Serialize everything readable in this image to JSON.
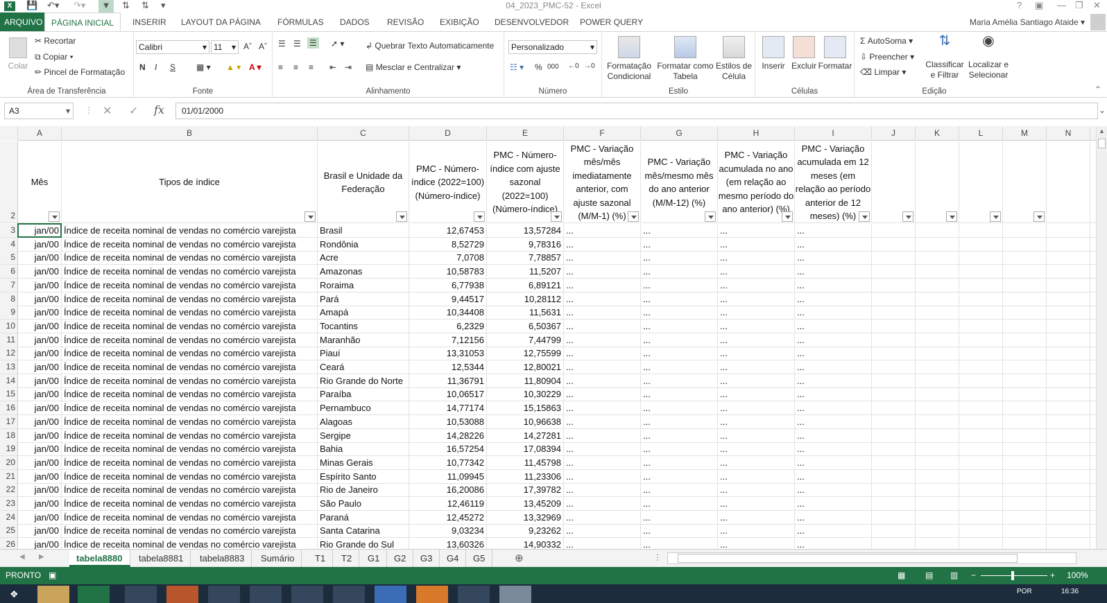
{
  "window": {
    "title": "04_2023_PMC-52 - Excel",
    "help": "?"
  },
  "tabs": [
    "ARQUIVO",
    "PÁGINA INICIAL",
    "INSERIR",
    "LAYOUT DA PÁGINA",
    "FÓRMULAS",
    "DADOS",
    "REVISÃO",
    "EXIBIÇÃO",
    "DESENVOLVEDOR",
    "POWER QUERY"
  ],
  "user": "Maria Amélia Santiago Ataide",
  "ribbon": {
    "clipboard": {
      "paste": "Colar",
      "cut": "Recortar",
      "copy": "Copiar",
      "painter": "Pincel de Formatação",
      "label": "Área de Transferência"
    },
    "font": {
      "name": "Calibri",
      "size": "11",
      "label": "Fonte",
      "bold": "N",
      "italic": "I",
      "underline": "S"
    },
    "alignment": {
      "wrap": "Quebrar Texto Automaticamente",
      "merge": "Mesclar e Centralizar",
      "label": "Alinhamento"
    },
    "number": {
      "format": "Personalizado",
      "label": "Número",
      "percent": "%",
      "thousands": "000"
    },
    "styles": {
      "cond": "Formatação Condicional",
      "table": "Formatar como Tabela",
      "cell": "Estilos de Célula",
      "label": "Estilo"
    },
    "cells": {
      "insert": "Inserir",
      "delete": "Excluir",
      "format": "Formatar",
      "label": "Células"
    },
    "editing": {
      "autosum": "AutoSoma",
      "fill": "Preencher",
      "clear": "Limpar",
      "sort": "Classificar e Filtrar",
      "find": "Localizar e Selecionar",
      "label": "Edição"
    }
  },
  "formula": {
    "namebox": "A3",
    "value": "01/01/2000",
    "fx": "fx"
  },
  "columns": [
    "A",
    "B",
    "C",
    "D",
    "E",
    "F",
    "G",
    "H",
    "I",
    "J",
    "K",
    "L",
    "M",
    "N"
  ],
  "headers": {
    "A": "Mês",
    "B": "Tipos de índice",
    "C": "Brasil e Unidade da Federação",
    "D": "PMC - Número-índice (2022=100) (Número-índice)",
    "E": "PMC - Número-índice com ajuste sazonal (2022=100) (Número-índice)",
    "F": "PMC - Variação mês/mês imediatamente anterior, com ajuste sazonal (M/M-1) (%)",
    "G": "PMC - Variação mês/mesmo mês do ano anterior (M/M-12) (%)",
    "H": "PMC - Variação acumulada no ano (em relação ao mesmo período do ano anterior) (%)",
    "I": "PMC - Variação acumulada em 12 meses (em relação ao período anterior de 12 meses) (%)"
  },
  "rows": [
    {
      "n": "3",
      "a": "jan/00",
      "b": "Índice de receita nominal de vendas no comércio varejista",
      "c": "Brasil",
      "d": "12,67453",
      "e": "13,57284",
      "f": "...",
      "g": "...",
      "h": "...",
      "i": "..."
    },
    {
      "n": "4",
      "a": "jan/00",
      "b": "Índice de receita nominal de vendas no comércio varejista",
      "c": "Rondônia",
      "d": "8,52729",
      "e": "9,78316",
      "f": "...",
      "g": "...",
      "h": "...",
      "i": "..."
    },
    {
      "n": "5",
      "a": "jan/00",
      "b": "Índice de receita nominal de vendas no comércio varejista",
      "c": "Acre",
      "d": "7,0708",
      "e": "7,78857",
      "f": "...",
      "g": "...",
      "h": "...",
      "i": "..."
    },
    {
      "n": "6",
      "a": "jan/00",
      "b": "Índice de receita nominal de vendas no comércio varejista",
      "c": "Amazonas",
      "d": "10,58783",
      "e": "11,5207",
      "f": "...",
      "g": "...",
      "h": "...",
      "i": "..."
    },
    {
      "n": "7",
      "a": "jan/00",
      "b": "Índice de receita nominal de vendas no comércio varejista",
      "c": "Roraima",
      "d": "6,77938",
      "e": "6,89121",
      "f": "...",
      "g": "...",
      "h": "...",
      "i": "..."
    },
    {
      "n": "8",
      "a": "jan/00",
      "b": "Índice de receita nominal de vendas no comércio varejista",
      "c": "Pará",
      "d": "9,44517",
      "e": "10,28112",
      "f": "...",
      "g": "...",
      "h": "...",
      "i": "..."
    },
    {
      "n": "9",
      "a": "jan/00",
      "b": "Índice de receita nominal de vendas no comércio varejista",
      "c": "Amapá",
      "d": "10,34408",
      "e": "11,5631",
      "f": "...",
      "g": "...",
      "h": "...",
      "i": "..."
    },
    {
      "n": "10",
      "a": "jan/00",
      "b": "Índice de receita nominal de vendas no comércio varejista",
      "c": "Tocantins",
      "d": "6,2329",
      "e": "6,50367",
      "f": "...",
      "g": "...",
      "h": "...",
      "i": "..."
    },
    {
      "n": "11",
      "a": "jan/00",
      "b": "Índice de receita nominal de vendas no comércio varejista",
      "c": "Maranhão",
      "d": "7,12156",
      "e": "7,44799",
      "f": "...",
      "g": "...",
      "h": "...",
      "i": "..."
    },
    {
      "n": "12",
      "a": "jan/00",
      "b": "Índice de receita nominal de vendas no comércio varejista",
      "c": "Piauí",
      "d": "13,31053",
      "e": "12,75599",
      "f": "...",
      "g": "...",
      "h": "...",
      "i": "..."
    },
    {
      "n": "13",
      "a": "jan/00",
      "b": "Índice de receita nominal de vendas no comércio varejista",
      "c": "Ceará",
      "d": "12,5344",
      "e": "12,80021",
      "f": "...",
      "g": "...",
      "h": "...",
      "i": "..."
    },
    {
      "n": "14",
      "a": "jan/00",
      "b": "Índice de receita nominal de vendas no comércio varejista",
      "c": "Rio Grande do Norte",
      "d": "11,36791",
      "e": "11,80904",
      "f": "...",
      "g": "...",
      "h": "...",
      "i": "..."
    },
    {
      "n": "15",
      "a": "jan/00",
      "b": "Índice de receita nominal de vendas no comércio varejista",
      "c": "Paraíba",
      "d": "10,06517",
      "e": "10,30229",
      "f": "...",
      "g": "...",
      "h": "...",
      "i": "..."
    },
    {
      "n": "16",
      "a": "jan/00",
      "b": "Índice de receita nominal de vendas no comércio varejista",
      "c": "Pernambuco",
      "d": "14,77174",
      "e": "15,15863",
      "f": "...",
      "g": "...",
      "h": "...",
      "i": "..."
    },
    {
      "n": "17",
      "a": "jan/00",
      "b": "Índice de receita nominal de vendas no comércio varejista",
      "c": "Alagoas",
      "d": "10,53088",
      "e": "10,96638",
      "f": "...",
      "g": "...",
      "h": "...",
      "i": "..."
    },
    {
      "n": "18",
      "a": "jan/00",
      "b": "Índice de receita nominal de vendas no comércio varejista",
      "c": "Sergipe",
      "d": "14,28226",
      "e": "14,27281",
      "f": "...",
      "g": "...",
      "h": "...",
      "i": "..."
    },
    {
      "n": "19",
      "a": "jan/00",
      "b": "Índice de receita nominal de vendas no comércio varejista",
      "c": "Bahia",
      "d": "16,57254",
      "e": "17,08394",
      "f": "...",
      "g": "...",
      "h": "...",
      "i": "..."
    },
    {
      "n": "20",
      "a": "jan/00",
      "b": "Índice de receita nominal de vendas no comércio varejista",
      "c": "Minas Gerais",
      "d": "10,77342",
      "e": "11,45798",
      "f": "...",
      "g": "...",
      "h": "...",
      "i": "..."
    },
    {
      "n": "21",
      "a": "jan/00",
      "b": "Índice de receita nominal de vendas no comércio varejista",
      "c": "Espírito Santo",
      "d": "11,09945",
      "e": "11,23306",
      "f": "...",
      "g": "...",
      "h": "...",
      "i": "..."
    },
    {
      "n": "22",
      "a": "jan/00",
      "b": "Índice de receita nominal de vendas no comércio varejista",
      "c": "Rio de Janeiro",
      "d": "16,20086",
      "e": "17,39782",
      "f": "...",
      "g": "...",
      "h": "...",
      "i": "..."
    },
    {
      "n": "23",
      "a": "jan/00",
      "b": "Índice de receita nominal de vendas no comércio varejista",
      "c": "São Paulo",
      "d": "12,46119",
      "e": "13,45209",
      "f": "...",
      "g": "...",
      "h": "...",
      "i": "..."
    },
    {
      "n": "24",
      "a": "jan/00",
      "b": "Índice de receita nominal de vendas no comércio varejista",
      "c": "Paraná",
      "d": "12,45272",
      "e": "13,32969",
      "f": "...",
      "g": "...",
      "h": "...",
      "i": "..."
    },
    {
      "n": "25",
      "a": "jan/00",
      "b": "Índice de receita nominal de vendas no comércio varejista",
      "c": "Santa Catarina",
      "d": "9,03234",
      "e": "9,23262",
      "f": "...",
      "g": "...",
      "h": "...",
      "i": "..."
    },
    {
      "n": "26",
      "a": "jan/00",
      "b": "Índice de receita nominal de vendas no comércio varejista",
      "c": "Rio Grande do Sul",
      "d": "13,60326",
      "e": "14,90332",
      "f": "...",
      "g": "...",
      "h": "...",
      "i": "..."
    }
  ],
  "header_row_number": "2",
  "sheets": [
    "tabela8880",
    "tabela8881",
    "tabela8883",
    "Sumário",
    "T1",
    "T2",
    "G1",
    "G2",
    "G3",
    "G4",
    "G5"
  ],
  "status": {
    "ready": "PRONTO",
    "zoom": "100%"
  },
  "taskbar": {
    "lang": "POR",
    "time": "16:36"
  },
  "colors": {
    "excel_green": "#217346",
    "taskbar": "#1c2c3c"
  }
}
